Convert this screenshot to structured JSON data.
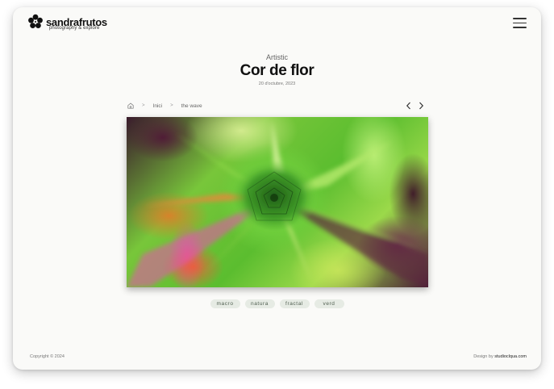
{
  "header": {
    "brand_name": "sandrafrutos",
    "brand_tagline": "photography & explore",
    "logo_icon": "flower-icon",
    "menu_icon": "hamburger-menu-icon"
  },
  "post": {
    "category": "Artistic",
    "title": "Cor de flor",
    "date": "20 d'octubre, 2023"
  },
  "breadcrumb": {
    "home_icon": "home-icon",
    "items": [
      "Inici",
      "the wave"
    ],
    "separator": ">"
  },
  "gallery_nav": {
    "prev_icon": "chevron-left-icon",
    "next_icon": "chevron-right-icon"
  },
  "tags": [
    "macro",
    "natura",
    "fractal",
    "verd"
  ],
  "footer": {
    "copyright": "Copyright © 2024",
    "design_prefix": "Design by",
    "design_link": "studioclqua.com"
  },
  "colors": {
    "card_bg": "#fafaf8",
    "tag_bg": "#e6ebe4",
    "tag_text": "#4f5e4f",
    "title": "#101010"
  }
}
